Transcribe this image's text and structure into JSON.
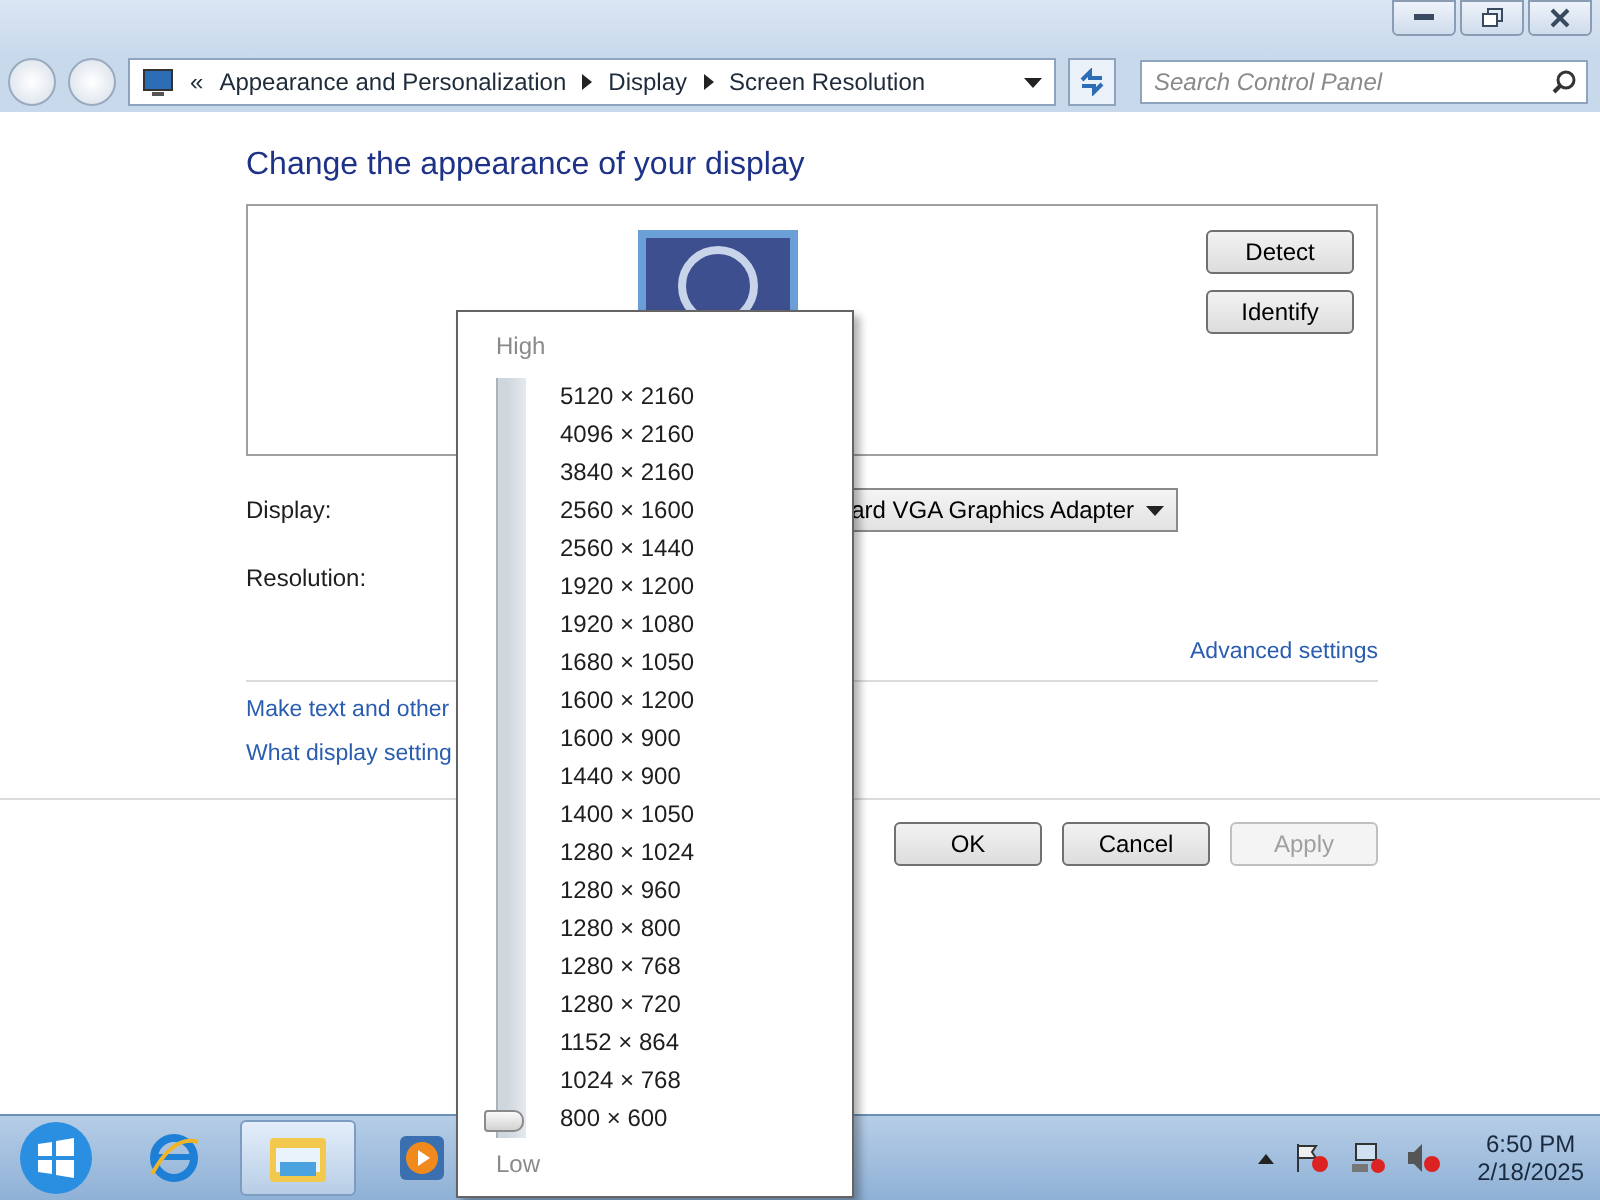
{
  "address_bar": {
    "prefix": "«",
    "crumbs": [
      "Appearance and Personalization",
      "Display",
      "Screen Resolution"
    ]
  },
  "search": {
    "placeholder": "Search Control Panel"
  },
  "heading": "Change the appearance of your display",
  "buttons_side": [
    "Detect",
    "Identify"
  ],
  "display": {
    "label": "Display:",
    "value": "ard VGA Graphics Adapter"
  },
  "resolution": {
    "label": "Resolution:"
  },
  "advanced_link": "Advanced settings",
  "links": [
    "Make text and other",
    "What display setting"
  ],
  "dialog_buttons": [
    {
      "label": "OK",
      "disabled": false
    },
    {
      "label": "Cancel",
      "disabled": false
    },
    {
      "label": "Apply",
      "disabled": true
    }
  ],
  "resolution_popup": {
    "high": "High",
    "low": "Low",
    "level": 0,
    "options": [
      "5120 × 2160",
      "4096 × 2160",
      "3840 × 2160",
      "2560 × 1600",
      "2560 × 1440",
      "1920 × 1200",
      "1920 × 1080",
      "1680 × 1050",
      "1600 × 1200",
      "1600 × 900",
      "1440 × 900",
      "1400 × 1050",
      "1280 × 1024",
      "1280 × 960",
      "1280 × 800",
      "1280 × 768",
      "1280 × 720",
      "1152 × 864",
      "1024 × 768",
      "800 × 600"
    ]
  },
  "taskbar": {
    "apps": [
      {
        "kind": "browser",
        "selected": false
      },
      {
        "kind": "folder",
        "selected": true
      },
      {
        "kind": "media",
        "selected": false
      }
    ],
    "time": "6:50 PM",
    "date": "2/18/2025"
  }
}
